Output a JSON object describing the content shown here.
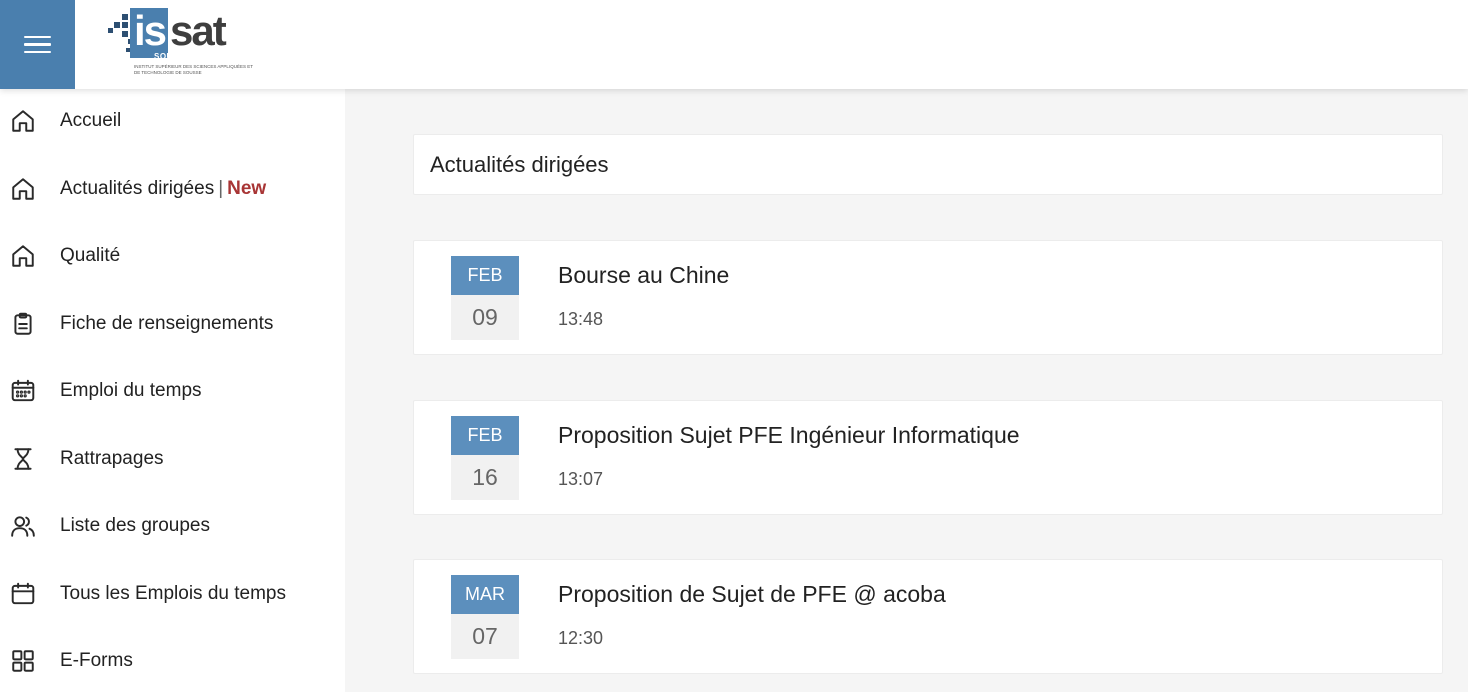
{
  "header": {
    "menu_icon": "hamburger-menu-icon",
    "logo": {
      "brand_is": "is",
      "brand_sat": "sat",
      "brand_sousse": "SOUSSE",
      "brand_subtitle": "Institut Supérieur des Sciences Appliquées et de Technologie de Sousse"
    },
    "accent_color": "#4a7fae"
  },
  "sidebar": {
    "items": [
      {
        "label": "Accueil",
        "icon": "home-icon"
      },
      {
        "label": "Actualités dirigées",
        "separator": "|",
        "badge": "New",
        "icon": "home-icon"
      },
      {
        "label": "Qualité",
        "icon": "home-icon"
      },
      {
        "label": "Fiche de renseignements",
        "icon": "clipboard-icon"
      },
      {
        "label": "Emploi du temps",
        "icon": "calendar-dots-icon"
      },
      {
        "label": "Rattrapages",
        "icon": "hourglass-icon"
      },
      {
        "label": "Liste des groupes",
        "icon": "users-icon"
      },
      {
        "label": "Tous les Emplois du temps",
        "icon": "calendar-icon"
      },
      {
        "label": "E-Forms",
        "icon": "grid-icon"
      }
    ],
    "badge_color": "#a83535"
  },
  "main": {
    "section_title": "Actualités dirigées",
    "news": [
      {
        "month": "FEB",
        "day": "09",
        "title": "Bourse au Chine",
        "time": "13:48"
      },
      {
        "month": "FEB",
        "day": "16",
        "title": "Proposition Sujet PFE Ingénieur Informatique",
        "time": "13:07"
      },
      {
        "month": "MAR",
        "day": "07",
        "title": "Proposition de Sujet de PFE @ acoba",
        "time": "12:30"
      }
    ],
    "date_header_color": "#5c8fbd"
  }
}
